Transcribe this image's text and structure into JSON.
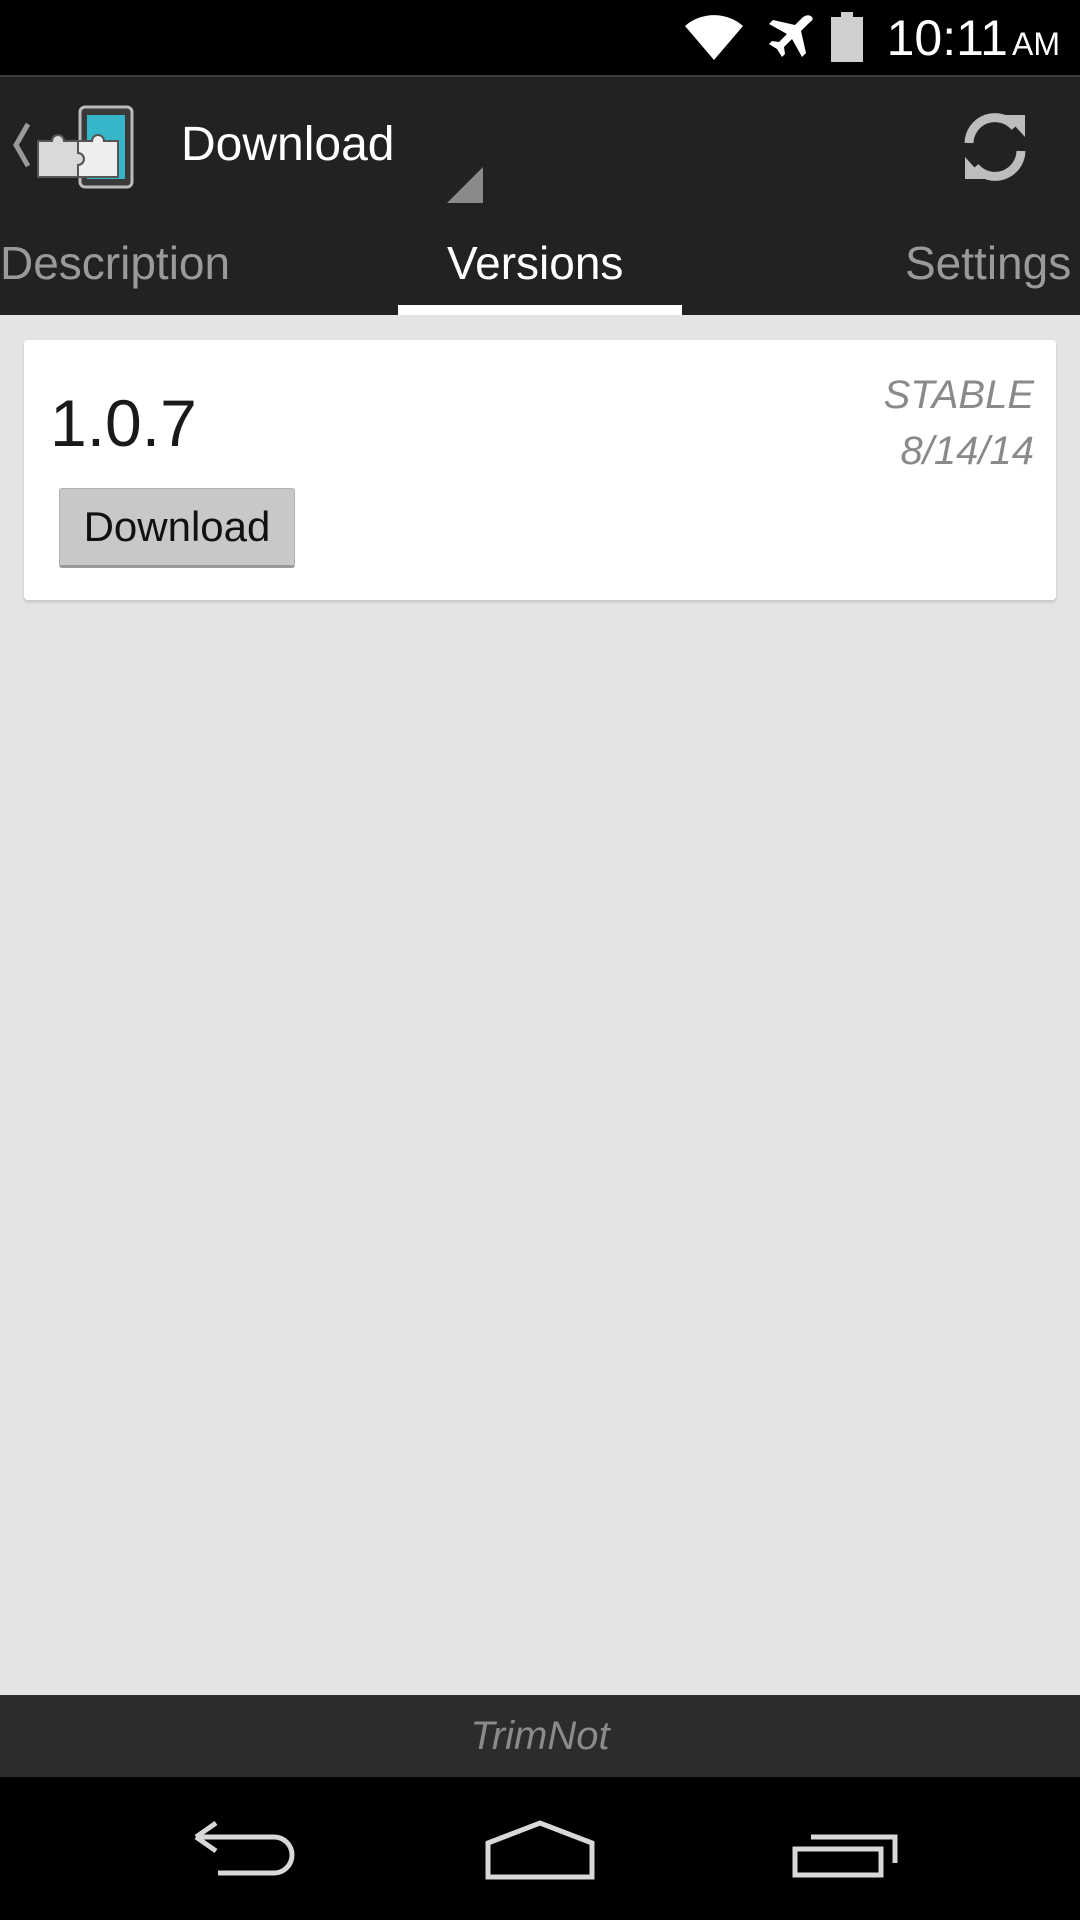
{
  "status_bar": {
    "time": "10:11",
    "ampm": "AM",
    "icons": [
      "wifi-icon",
      "airplane-mode-icon",
      "battery-icon"
    ]
  },
  "action_bar": {
    "title": "Download",
    "icons": [
      "up-caret-icon",
      "xposed-app-logo-icon",
      "spinner-triangle-icon",
      "refresh-icon"
    ]
  },
  "tabs": [
    {
      "label": "Description",
      "selected": false
    },
    {
      "label": "Versions",
      "selected": true
    },
    {
      "label": "Settings",
      "selected": false
    }
  ],
  "version_card": {
    "version": "1.0.7",
    "release_type": "STABLE",
    "date": "8/14/14",
    "button_label": "Download"
  },
  "footer": {
    "text": "TrimNot"
  },
  "nav_bar": {
    "icons": [
      "back-icon",
      "home-icon",
      "recents-icon"
    ]
  },
  "colors": {
    "action_bar": "#222222",
    "background": "#e4e4e4",
    "logo_accent": "#35b7c9"
  }
}
